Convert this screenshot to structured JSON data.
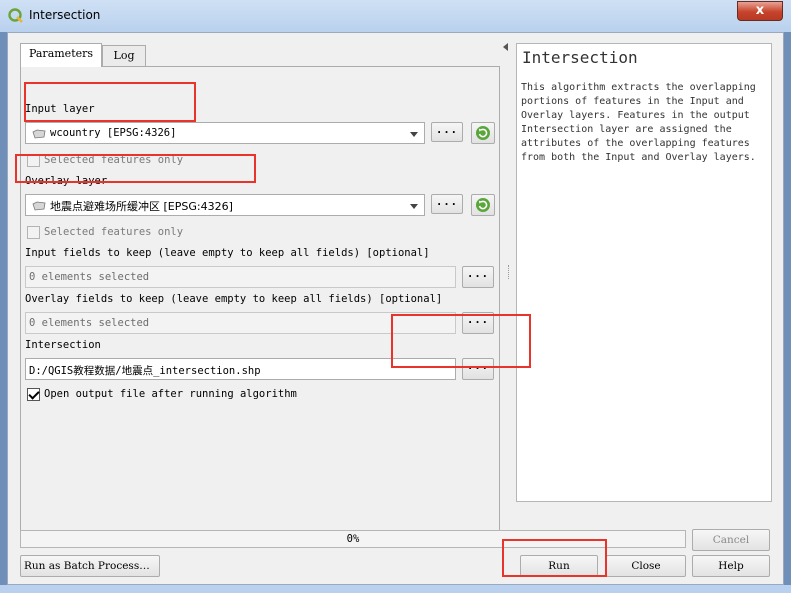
{
  "window": {
    "title": "Intersection",
    "close_glyph": "x",
    "icon": "qgis-icon"
  },
  "tabs": [
    {
      "label": "Parameters"
    },
    {
      "label": "Log"
    }
  ],
  "params": {
    "input_layer": {
      "label": "Input layer",
      "value": "wcountry [EPSG:4326]",
      "selected_only_label": "Selected features only"
    },
    "overlay_layer": {
      "label": "Overlay layer",
      "value": "地震点避难场所缓冲区 [EPSG:4326]",
      "selected_only_label": "Selected features only"
    },
    "input_fields": {
      "label": "Input fields to keep (leave empty to keep all fields) [optional]",
      "value": "0 elements selected"
    },
    "overlay_fields": {
      "label": "Overlay fields to keep (leave empty to keep all fields) [optional]",
      "value": "0 elements selected"
    },
    "output": {
      "label": "Intersection",
      "value": "D:/QGIS教程数据/地震点_intersection.shp"
    },
    "open_after": {
      "label": "Open output file after running algorithm",
      "checked": true
    },
    "browse_label": "..."
  },
  "help": {
    "title": "Intersection",
    "text": "This algorithm extracts the overlapping\nportions of features in the Input and\nOverlay layers. Features in the output\nIntersection layer are assigned the\nattributes of the overlapping features\nfrom both the Input and Overlay layers."
  },
  "progress": {
    "percent_label": "0%",
    "value": 0
  },
  "buttons": {
    "cancel": "Cancel",
    "batch": "Run as Batch Process…",
    "run": "Run",
    "close": "Close",
    "help": "Help"
  },
  "colors": {
    "highlight": "#e8342a",
    "title_bar": "#b9d1ee",
    "close_button": "#c7432b"
  }
}
